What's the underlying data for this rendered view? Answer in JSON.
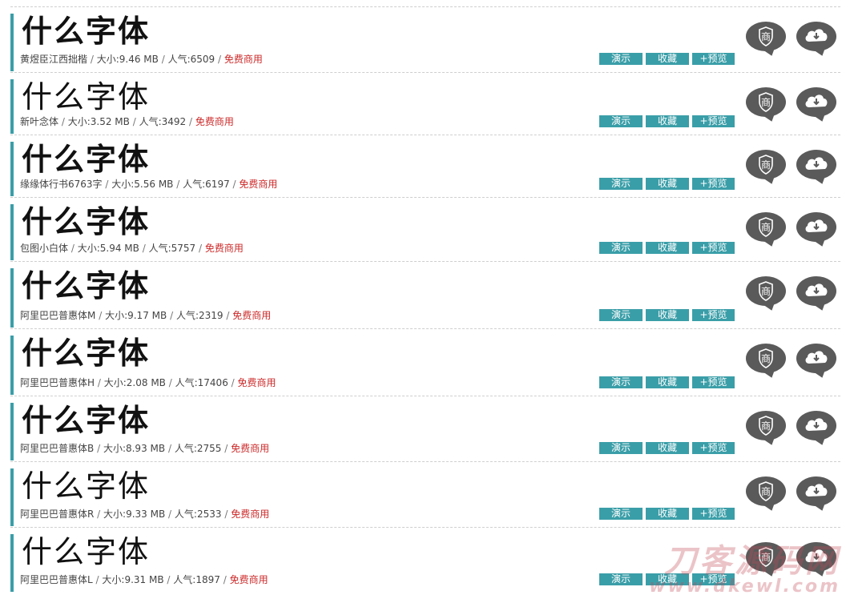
{
  "common": {
    "sample_text": "什么字体",
    "size_prefix": "大小:",
    "popularity_prefix": "人气:",
    "separator": "/",
    "license": "免费商用",
    "demo_label": "演示",
    "favorite_label": "收藏",
    "preview_label": "+预览",
    "commercial_glyph": "商"
  },
  "fonts": [
    {
      "name": "黄煜臣江西拙楷",
      "size": "9.46 MB",
      "popularity": "6509"
    },
    {
      "name": "新叶念体",
      "size": "3.52 MB",
      "popularity": "3492"
    },
    {
      "name": "缘缘体行书6763字",
      "size": "5.56 MB",
      "popularity": "6197"
    },
    {
      "name": "包图小白体",
      "size": "5.94 MB",
      "popularity": "5757"
    },
    {
      "name": "阿里巴巴普惠体M",
      "size": "9.17 MB",
      "popularity": "2319"
    },
    {
      "name": "阿里巴巴普惠体H",
      "size": "2.08 MB",
      "popularity": "17406"
    },
    {
      "name": "阿里巴巴普惠体B",
      "size": "8.93 MB",
      "popularity": "2755"
    },
    {
      "name": "阿里巴巴普惠体R",
      "size": "9.33 MB",
      "popularity": "2533"
    },
    {
      "name": "阿里巴巴普惠体L",
      "size": "9.31 MB",
      "popularity": "1897"
    }
  ],
  "watermark": {
    "title": "刀客源码网",
    "url": "www.dkewl.com"
  },
  "colors": {
    "accent": "#3a9ea8",
    "license": "#cc2a2a",
    "icon_bg": "#5a5a5a"
  }
}
